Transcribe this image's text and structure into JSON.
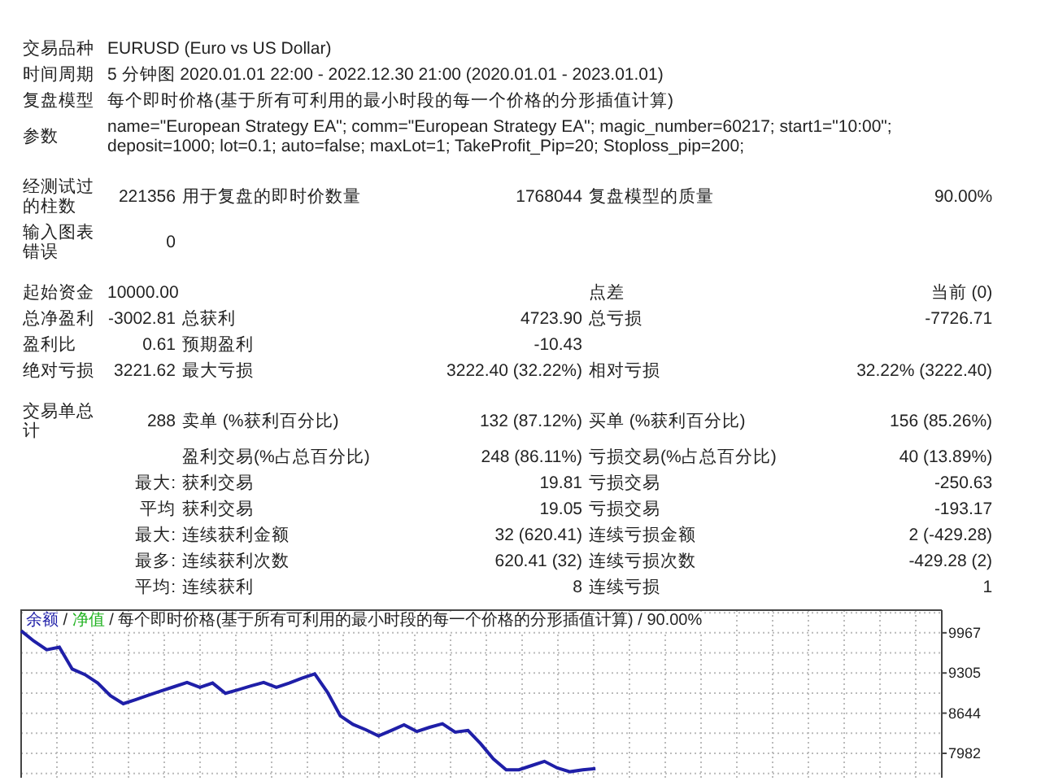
{
  "settings": [
    {
      "label": "交易品种",
      "value": "EURUSD (Euro vs US Dollar)"
    },
    {
      "label": "时间周期",
      "value": "5 分钟图 2020.01.01 22:00 - 2022.12.30 21:00 (2020.01.01 - 2023.01.01)"
    },
    {
      "label": "复盘模型",
      "value": "每个即时价格(基于所有可利用的最小时段的每一个价格的分形插值计算)"
    },
    {
      "label": "参数",
      "value": "name=\"European Strategy EA\"; comm=\"European Strategy EA\"; magic_number=60217; start1=\"10:00\"; deposit=1000; lot=0.1; auto=false; maxLot=1; TakeProfit_Pip=20; Stoploss_pip=200;"
    }
  ],
  "stat_groups": [
    [
      {
        "label": "经测试过的柱数",
        "value": "221356",
        "item_1": "用于复盘的即时价数量",
        "value_1": "1768044",
        "item_2": "复盘模型的质量",
        "value_2": "90.00%"
      },
      {
        "label": "输入图表错误",
        "value": "0"
      }
    ],
    [
      {
        "label": "起始资金",
        "value": "10000.00",
        "item_2": "点差",
        "value_2": "当前 (0)"
      },
      {
        "label": "总净盈利",
        "value": "-3002.81",
        "item_1": "总获利",
        "value_1": "4723.90",
        "item_2": "总亏损",
        "value_2": "-7726.71"
      },
      {
        "label": "盈利比",
        "value": "0.61",
        "item_1": "预期盈利",
        "value_1": "-10.43"
      },
      {
        "label": "绝对亏损",
        "value": "3221.62",
        "item_1": "最大亏损",
        "value_1": "3222.40 (32.22%)",
        "item_2": "相对亏损",
        "value_2": "32.22% (3222.40)"
      }
    ],
    [
      {
        "label": "交易单总计",
        "value": "288",
        "item_1": "卖单 (%获利百分比)",
        "value_1": "132 (87.12%)",
        "item_2": "买单 (%获利百分比)",
        "value_2": "156 (85.26%)"
      },
      {
        "item_1": "盈利交易(%占总百分比)",
        "value_1": "248 (86.11%)",
        "item_2": "亏损交易(%占总百分比)",
        "value_2": "40 (13.89%)"
      },
      {
        "value": "最大:",
        "item_1": "获利交易",
        "value_1": "19.81",
        "item_2": "亏损交易",
        "value_2": "-250.63"
      },
      {
        "value": "平均",
        "item_1": "获利交易",
        "value_1": "19.05",
        "item_2": "亏损交易",
        "value_2": "-193.17"
      },
      {
        "value": "最大:",
        "item_1": "连续获利金额",
        "value_1": "32 (620.41)",
        "item_2": "连续亏损金额",
        "value_2": "2 (-429.28)"
      },
      {
        "value": "最多:",
        "item_1": "连续获利次数",
        "value_1": "620.41 (32)",
        "item_2": "连续亏损次数",
        "value_2": "-429.28 (2)"
      },
      {
        "value": "平均:",
        "item_1": "连续获利",
        "value_1": "8",
        "item_2": "连续亏损",
        "value_2": "1"
      }
    ]
  ],
  "chart": {
    "legend": [
      {
        "text": "净值",
        "color": "#22b322"
      }
    ],
    "separator": "/",
    "model": "每个即时价格(基于所有可利用的最小时段的每一个价格的分形插值计算)",
    "quality": "90.00%",
    "chart_data": {
      "type": "line",
      "categories": [
        null,
        null,
        null,
        null,
        null,
        null,
        null,
        null,
        null,
        null,
        null,
        null,
        null,
        null,
        null,
        null,
        null,
        null,
        null,
        null,
        null,
        null,
        null,
        null,
        null,
        null,
        null,
        null,
        null,
        null,
        null,
        null,
        null,
        null,
        null,
        null,
        null,
        null,
        null,
        null,
        null,
        null,
        null,
        null,
        null,
        null,
        null,
        null,
        null,
        null,
        null,
        null,
        null,
        null,
        null,
        null,
        null,
        null,
        null,
        null,
        null,
        null,
        null,
        null,
        null,
        null,
        null,
        null,
        null,
        null,
        null,
        null,
        null
      ],
      "ylim": [
        7580,
        10340
      ],
      "yticks": [
        9967,
        9305,
        8644,
        7982
      ],
      "grid": true,
      "series": [
        {
          "name": "余额",
          "color": "#1f1fa8",
          "values": [
            10000,
            9830,
            9690,
            9730,
            9370,
            9280,
            9140,
            8930,
            8800,
            8870,
            8940,
            9010,
            9080,
            9150,
            9070,
            9140,
            8970,
            9030,
            9090,
            9150,
            9070,
            9140,
            9220,
            9290,
            8990,
            8600,
            8460,
            8370,
            8270,
            8360,
            8450,
            8340,
            8410,
            8470,
            8330,
            8360,
            8140,
            7890,
            7710,
            7710,
            7780,
            7850,
            7740,
            7680,
            7710,
            7730,
            null,
            null,
            null,
            null,
            null,
            null,
            null,
            null,
            null,
            null,
            null,
            null,
            null,
            null,
            null,
            null,
            null,
            null,
            null,
            null,
            null,
            null,
            null,
            null,
            null,
            null,
            null
          ]
        }
      ]
    }
  }
}
